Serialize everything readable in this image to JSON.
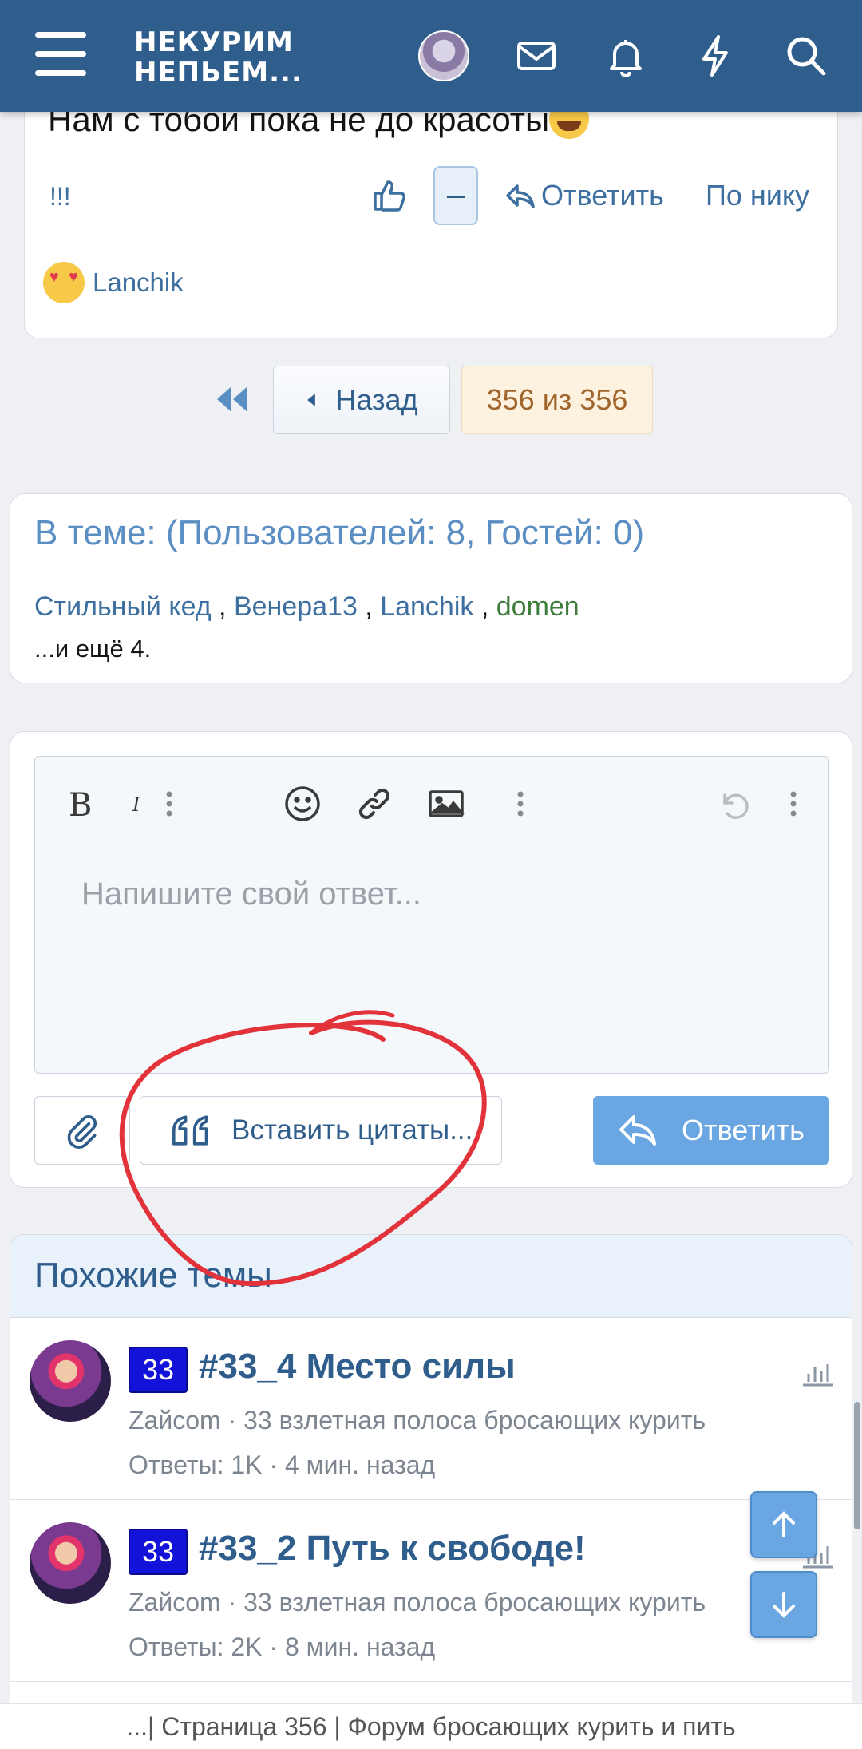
{
  "header": {
    "logo_line1": "НЕКУРИМ",
    "logo_line2": "НЕПЬЕМ...",
    "icons": [
      "menu-icon",
      "mail-icon",
      "bell-icon",
      "lightning-icon",
      "search-icon"
    ],
    "brand_color": "#2f5d8c"
  },
  "post": {
    "text": "Нам с тобой пока не до красоты",
    "signature": "!!!",
    "minus_label": "–",
    "reply_label": "Ответить",
    "bynick_label": "По нику",
    "reactor_name": "Lanchik"
  },
  "pagination": {
    "back_label": "Назад",
    "current_label": "356 из 356"
  },
  "online": {
    "title": "В теме: (Пользователей: 8, Гостей: 0)",
    "users": [
      "Стильный кед",
      "Венера13",
      "Lanchik",
      "domen"
    ],
    "sep": " , ",
    "more": "...и ещё 4."
  },
  "editor": {
    "placeholder": "Напишите свой ответ...",
    "insert_quotes_label": "Вставить цитаты...",
    "reply_button_label": "Ответить"
  },
  "similar": {
    "title": "Похожие темы",
    "threads": [
      {
        "badge": "33",
        "title": "#33_4 Место силы",
        "author": "Zaйcom",
        "forum": "33 взлетная полоса бросающих курить",
        "meta_sep": " · ",
        "replies": "Ответы: 1K",
        "time": "4 мин. назад"
      },
      {
        "badge": "33",
        "title": "#33_2 Путь к свободе!",
        "author": "Zaйcom",
        "forum": "33 взлетная полоса бросающих курить",
        "meta_sep": " · ",
        "replies": "Ответы: 2K",
        "time": "8 мин. назад"
      }
    ]
  },
  "browser": {
    "page_title": "...| Страница 356 | Форум бросающих курить и пить"
  }
}
